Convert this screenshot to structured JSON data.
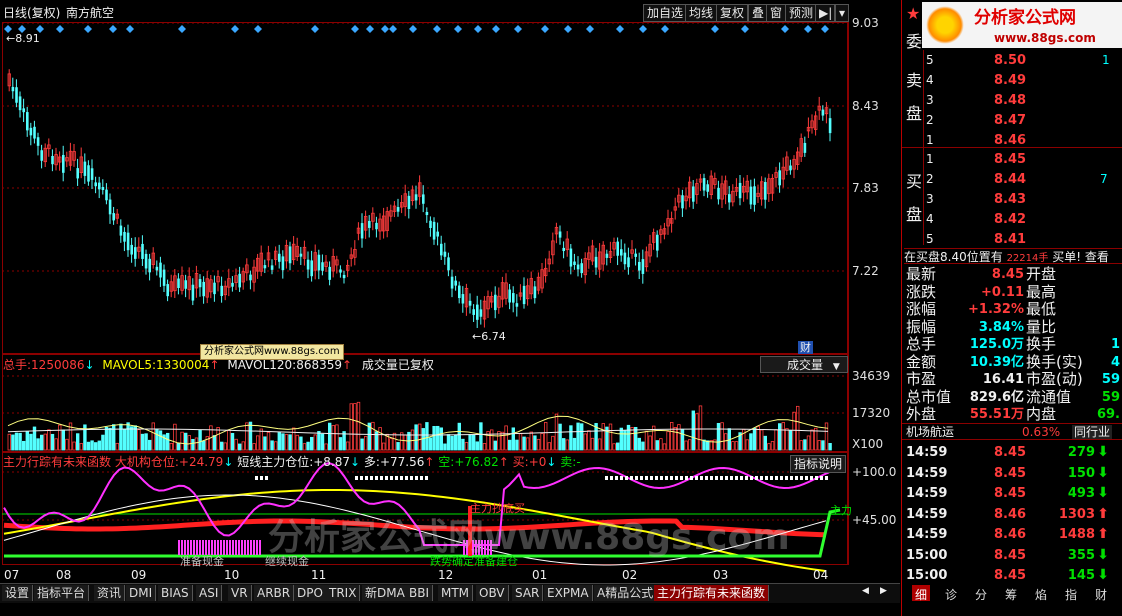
{
  "header": {
    "chart_mode": "日线(复权)",
    "stock_name": "南方航空",
    "toolbar": [
      "加自选",
      "均线",
      "复权",
      "叠",
      "窗",
      "预测"
    ]
  },
  "price_panel": {
    "axis_ticks": [
      "9.03",
      "8.43",
      "7.83",
      "7.22"
    ],
    "high_mark": "←8.91",
    "low_mark": "←6.74",
    "cai_label": "财",
    "watermark_small": "分析家公式网www.88gs.com"
  },
  "volume_panel": {
    "title_label": "总手:",
    "total": "1250086",
    "mavol5_label": "MAVOL5:",
    "mavol5": "1330004",
    "mavol120_label": "MAVOL120:",
    "mavol120": "868359",
    "note": "成交量已复权",
    "dropdown": "成交量",
    "axis_ticks": [
      "34639",
      "17320",
      "X100"
    ]
  },
  "indicator_panel": {
    "name": "主力行踪有未来函数",
    "inst_label": "大机构仓位:",
    "inst_value": "+24.79",
    "short_label": "短线主力仓位:",
    "short_value": "+8.87",
    "duo_label": "多:",
    "duo_value": "+77.56",
    "kong_label": "空:",
    "kong_value": "+76.82",
    "mai_label": "买:",
    "mai_value": "+0",
    "mai2_label": "卖:",
    "mai2_value": "-",
    "help_button": "指标说明",
    "axis_ticks": [
      "+100.0",
      "+45.00"
    ],
    "zhuli_label": "主力",
    "chaodi_label": "主力抄底买",
    "zhunbei_label": "准备现金",
    "jixu_label": "继续现金",
    "diepo_label": "跌势确定准备建仓",
    "watermark": "分析家公式网www.88gs.com"
  },
  "x_axis": [
    "07",
    "08",
    "09",
    "10",
    "11",
    "12",
    "01",
    "02",
    "03",
    "04"
  ],
  "bottom_tabs": [
    "设置",
    "指标平台",
    "资讯",
    "DMI",
    "BIAS",
    "ASI",
    "VR",
    "ARBR",
    "DPO",
    "TRIX",
    "新DMA",
    "BBI",
    "MTM",
    "OBV",
    "SAR",
    "EXPMA",
    "A精品公式",
    "主力行踪有未来函数"
  ],
  "right_bottom_tabs": [
    "细",
    "诊",
    "分",
    "筹",
    "焰",
    "指",
    "财"
  ],
  "logo": {
    "title": "分析家公式网",
    "url": "www.88gs.com"
  },
  "order_book": {
    "wei_label": "委",
    "sell_label": [
      "卖",
      "盘"
    ],
    "buy_label": [
      "买",
      "盘"
    ],
    "sells": [
      {
        "level": "5",
        "price": "8.50"
      },
      {
        "level": "4",
        "price": "8.49"
      },
      {
        "level": "3",
        "price": "8.48"
      },
      {
        "level": "2",
        "price": "8.47"
      },
      {
        "level": "1",
        "price": "8.46"
      }
    ],
    "buys": [
      {
        "level": "1",
        "price": "8.45"
      },
      {
        "level": "2",
        "price": "8.44"
      },
      {
        "level": "3",
        "price": "8.43"
      },
      {
        "level": "4",
        "price": "8.42"
      },
      {
        "level": "5",
        "price": "8.41"
      }
    ],
    "sell_vol_partial": "1",
    "buy_vol_partial": "7"
  },
  "ticker_line": {
    "text1": "在买盘8.40位置有",
    "text2": "22214手",
    "text3": "买单! 查看"
  },
  "quote": [
    {
      "label": "最新",
      "value": "8.45",
      "label2": "开盘"
    },
    {
      "label": "涨跌",
      "value": "+0.11",
      "label2": "最高"
    },
    {
      "label": "涨幅",
      "value": "+1.32%",
      "label2": "最低"
    },
    {
      "label": "振幅",
      "value": "3.84%",
      "label2": "量比"
    },
    {
      "label": "总手",
      "value": "125.0万",
      "label2": "换手",
      "value2": "1"
    },
    {
      "label": "金额",
      "value": "10.39亿",
      "label2": "换手(实)",
      "value2": "4"
    },
    {
      "label": "市盈",
      "value": "16.41",
      "label2": "市盈(动)",
      "value2": "59"
    },
    {
      "label": "总市值",
      "value": "829.6亿",
      "label2": "流通值",
      "value2": "59"
    },
    {
      "label": "外盘",
      "value": "55.51万",
      "label2": "内盘",
      "value2": "69."
    }
  ],
  "sector": {
    "name": "机场航运",
    "change": "0.63%",
    "link": "同行业"
  },
  "trades": [
    {
      "time": "14:59",
      "price": "8.45",
      "vol": "279",
      "dir": "down"
    },
    {
      "time": "14:59",
      "price": "8.45",
      "vol": "150",
      "dir": "down"
    },
    {
      "time": "14:59",
      "price": "8.45",
      "vol": "493",
      "dir": "down"
    },
    {
      "time": "14:59",
      "price": "8.46",
      "vol": "1303",
      "dir": "up"
    },
    {
      "time": "14:59",
      "price": "8.46",
      "vol": "1488",
      "dir": "up"
    },
    {
      "time": "15:00",
      "price": "8.45",
      "vol": "355",
      "dir": "down"
    },
    {
      "time": "15:00",
      "price": "8.45",
      "vol": "145",
      "dir": "down"
    }
  ],
  "colors": {
    "up": "#ff3c3c",
    "down": "#54ffff",
    "bg": "#000000",
    "grid": "#8b0000"
  }
}
